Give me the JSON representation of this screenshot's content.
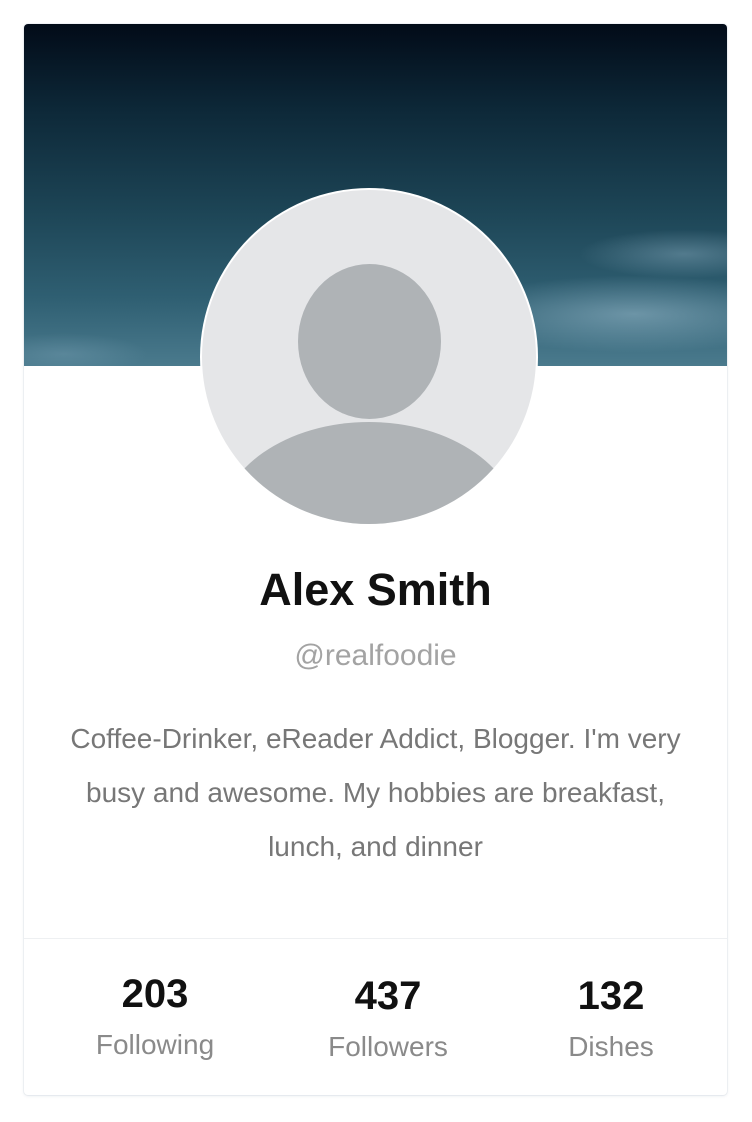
{
  "profile": {
    "name": "Alex Smith",
    "handle": "@realfoodie",
    "bio": "Coffee-Drinker, eReader Addict, Blogger. I'm very busy and awesome. My hobbies are breakfast, lunch, and dinner",
    "cover": "night-sky-cover-photo",
    "avatar": "default-user-avatar-icon"
  },
  "stats": [
    {
      "value": "203",
      "label": "Following"
    },
    {
      "value": "437",
      "label": "Followers"
    },
    {
      "value": "132",
      "label": "Dishes"
    }
  ],
  "colors": {
    "name_text": "#111111",
    "handle_text": "#a3a3a3",
    "bio_text": "#777777",
    "avatar_background": "#e5e6e8",
    "avatar_silhouette": "#afb3b6"
  }
}
